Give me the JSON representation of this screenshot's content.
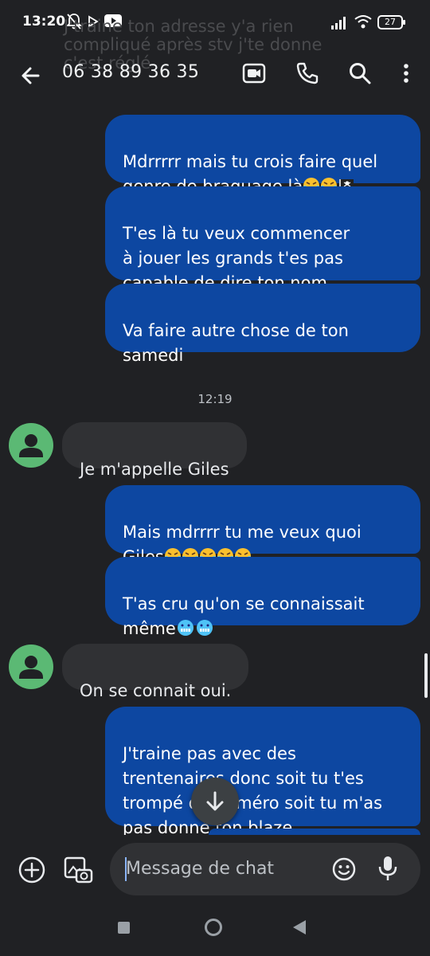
{
  "status_bar": {
    "time": "13:20",
    "battery": "27"
  },
  "notification_ghost": "J'traine ton adresse y'a rien \ncompliqué après stv j'te donne\nc'est réglé",
  "header": {
    "title": "06 38 89 36 35"
  },
  "conversation": {
    "timestamp": "12:19",
    "messages": [
      {
        "direction": "out",
        "text": "Mdrrrrr mais tu crois faire quel\ngenre de braquage là",
        "emojis": [
          "rofl",
          "rofl",
          "pirate-flag"
        ]
      },
      {
        "direction": "out",
        "text": "T'es là tu veux commencer\nà jouer les grands t'es pas\ncapable de dire ton nom"
      },
      {
        "direction": "out",
        "text": "Va faire autre chose de ton\nsamedi"
      },
      {
        "direction": "in",
        "text": "Je m'appelle Giles"
      },
      {
        "direction": "out",
        "text": "Mais mdrrrr tu me veux quoi\nGiles",
        "emojis": [
          "rofl",
          "rofl",
          "rofl",
          "rofl",
          "rofl"
        ]
      },
      {
        "direction": "out",
        "text": "T'as cru qu'on se connaissait\nmême",
        "emojis": [
          "cold-face",
          "cold-face"
        ]
      },
      {
        "direction": "in",
        "text": "On se connait oui."
      },
      {
        "direction": "out",
        "text": "J'traine pas avec des\ntrentenaires donc soit tu t'es\ntrompé de numéro soit tu m'as\npas donné ton blaze"
      }
    ]
  },
  "composer": {
    "placeholder": "Message de chat"
  },
  "colors": {
    "outgoing_bubble": "#0d47a1",
    "incoming_bubble": "#303134",
    "avatar": "#5bb974",
    "background": "#202124"
  },
  "icons": [
    "back-arrow-icon",
    "video-call-icon",
    "phone-icon",
    "search-icon",
    "more-vert-icon",
    "add-icon",
    "gallery-icon",
    "emoji-icon",
    "mic-icon",
    "arrow-down-icon"
  ]
}
